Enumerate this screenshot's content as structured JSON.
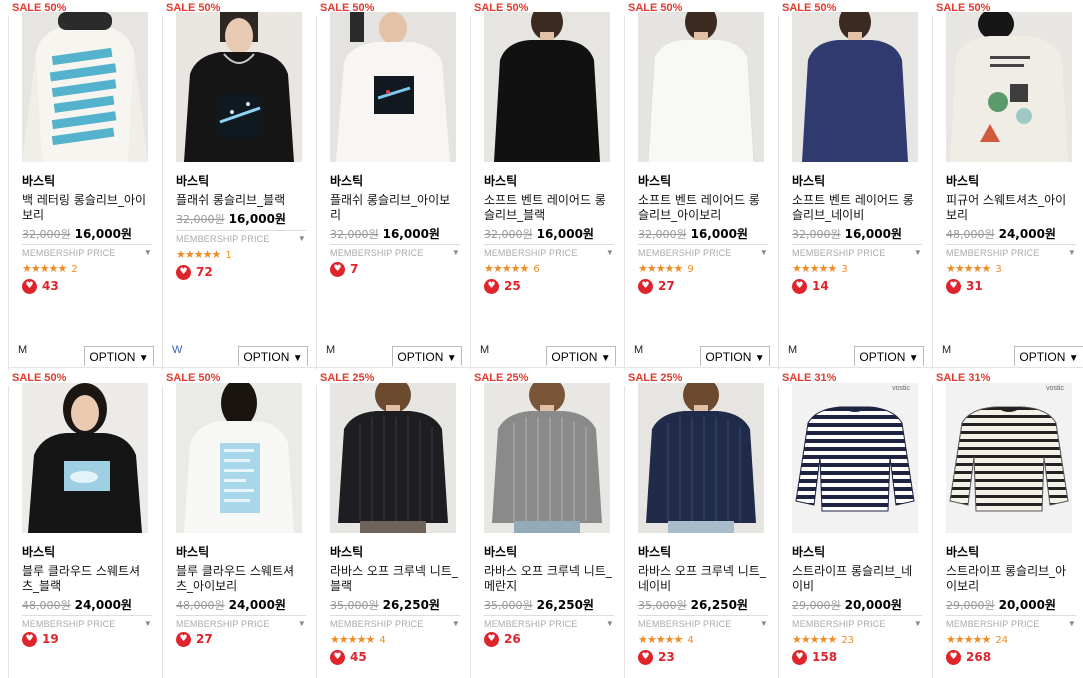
{
  "labels": {
    "membership": "MEMBERSHIP PRICE",
    "option": "OPTION",
    "option_arrow": "▼",
    "stars": "★★★★★",
    "heart": "♥"
  },
  "colors": {
    "sale": "#e03b2e",
    "like": "#e0242b",
    "star": "#f08a24"
  },
  "row1": [
    {
      "badge": "SALE 50%",
      "brand": "바스틱",
      "name": "백 레터링 롱슬리브_아이보리",
      "orig": "32,000원",
      "price": "16,000원",
      "rating": "2",
      "likes": "43",
      "size": "M"
    },
    {
      "badge": "SALE 50%",
      "brand": "바스틱",
      "name": "플래쉬 롱슬리브_블랙",
      "orig": "32,000원",
      "price": "16,000원",
      "rating": "1",
      "likes": "72",
      "size": "W"
    },
    {
      "badge": "SALE 50%",
      "brand": "바스틱",
      "name": "플래쉬 롱슬리브_아이보리",
      "orig": "32,000원",
      "price": "16,000원",
      "rating": "",
      "likes": "7",
      "size": "M"
    },
    {
      "badge": "SALE 50%",
      "brand": "바스틱",
      "name": "소프트 벤트 레이어드 롱슬리브_블랙",
      "orig": "32,000원",
      "price": "16,000원",
      "rating": "6",
      "likes": "25",
      "size": "M"
    },
    {
      "badge": "SALE 50%",
      "brand": "바스틱",
      "name": "소프트 벤트 레이어드 롱슬리브_아이보리",
      "orig": "32,000원",
      "price": "16,000원",
      "rating": "9",
      "likes": "27",
      "size": "M"
    },
    {
      "badge": "SALE 50%",
      "brand": "바스틱",
      "name": "소프트 벤트 레이어드 롱슬리브_네이비",
      "orig": "32,000원",
      "price": "16,000원",
      "rating": "3",
      "likes": "14",
      "size": "M"
    },
    {
      "badge": "SALE 50%",
      "brand": "바스틱",
      "name": "피규어 스웨트셔츠_아이보리",
      "orig": "48,000원",
      "price": "24,000원",
      "rating": "3",
      "likes": "31",
      "size": "M"
    }
  ],
  "row2": [
    {
      "badge": "SALE 50%",
      "brand": "바스틱",
      "name": "블루 클라우드 스웨트셔츠_블랙",
      "orig": "48,000원",
      "price": "24,000원",
      "rating": "",
      "likes": "19"
    },
    {
      "badge": "SALE 50%",
      "brand": "바스틱",
      "name": "블루 클라우드 스웨트셔츠_아이보리",
      "orig": "48,000원",
      "price": "24,000원",
      "rating": "",
      "likes": "27"
    },
    {
      "badge": "SALE 25%",
      "brand": "바스틱",
      "name": "라바스 오프 크루넥 니트_블랙",
      "orig": "35,000원",
      "price": "26,250원",
      "rating": "4",
      "likes": "45"
    },
    {
      "badge": "SALE 25%",
      "brand": "바스틱",
      "name": "라바스 오프 크루넥 니트_메란지",
      "orig": "35,000원",
      "price": "26,250원",
      "rating": "",
      "likes": "26"
    },
    {
      "badge": "SALE 25%",
      "brand": "바스틱",
      "name": "라바스 오프 크루넥 니트_네이비",
      "orig": "35,000원",
      "price": "26,250원",
      "rating": "4",
      "likes": "23"
    },
    {
      "badge": "SALE 31%",
      "brand": "바스틱",
      "name": "스트라이프 롱슬리브_네이비",
      "orig": "29,000원",
      "price": "20,000원",
      "rating": "23",
      "likes": "158",
      "tag": "vostic"
    },
    {
      "badge": "SALE 31%",
      "brand": "바스틱",
      "name": "스트라이프 롱슬리브_아이보리",
      "orig": "29,000원",
      "price": "20,000원",
      "rating": "24",
      "likes": "268",
      "tag": "vostic"
    }
  ]
}
